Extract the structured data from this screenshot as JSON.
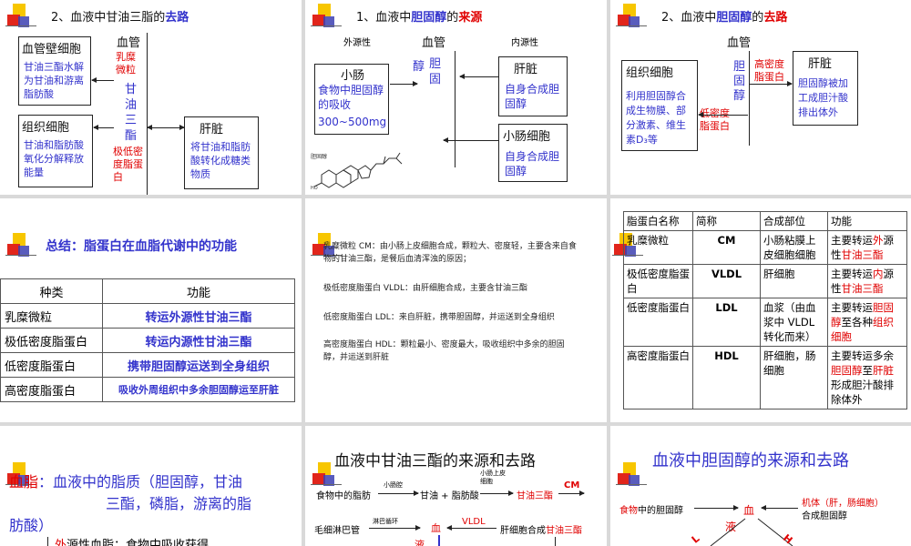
{
  "s1": {
    "title_prefix": "2、血液中甘油三脂的",
    "title_hl": "去路",
    "vessel": "血管",
    "cm": "乳糜微粒",
    "glycerol": "甘油三酯",
    "vldl": "极低密度脂蛋白",
    "wall_hd": "血管壁细胞",
    "wall_txt": "甘油三酯水解为甘油和游离脂肪酸",
    "tissue_hd": "组织细胞",
    "tissue_txt": "甘油和脂肪酸氧化分解释放能量",
    "liver_hd": "肝脏",
    "liver_txt": "将甘油和脂肪酸转化成糖类物质"
  },
  "s2": {
    "title_prefix": "1、血液中",
    "title_blue": "胆固醇",
    "title_mid": "的",
    "title_red": "来源",
    "exo": "外源性",
    "vessel": "血管",
    "endo": "内源性",
    "col_a": "醇",
    "col_b": "胆固",
    "sm_hd": "小肠",
    "sm_txt": "食物中胆固醇的吸收",
    "sm_amt": "300~500mg",
    "mol": "胆固醇",
    "liver_hd": "肝脏",
    "liver_txt": "自身合成胆固醇",
    "cell_hd": "小肠细胞",
    "cell_txt": "自身合成胆固醇"
  },
  "s3": {
    "title_prefix": "2、血液中",
    "title_blue": "胆固醇",
    "title_mid": "的",
    "title_red": "去路",
    "vessel": "血管",
    "chol": "胆固醇",
    "hdl": "高密度脂蛋白",
    "ldl": "低密度脂蛋白",
    "tissue_hd": "组织细胞",
    "tissue_txt": "利用胆固醇合成生物膜、部分激素、维生素D₃等",
    "liver_hd": "肝脏",
    "liver_txt": "胆固醇被加工成胆汁酸排出体外"
  },
  "s4": {
    "title": "总结：脂蛋白在血脂代谢中的功能",
    "head": [
      "种类",
      "功能"
    ],
    "rows": [
      [
        "乳糜微粒",
        "转运外源性甘油三酯"
      ],
      [
        "极低密度脂蛋白",
        "转运内源性甘油三酯"
      ],
      [
        "低密度脂蛋白",
        "携带胆固醇运送到全身组织"
      ],
      [
        "高密度脂蛋白",
        "吸收外周组织中多余胆固醇运至肝脏"
      ]
    ]
  },
  "s5": {
    "p1": "乳糜微粒 CM：由小肠上皮细胞合成，颗粒大、密度轻，主要含来自食物的甘油三酯，是餐后血清浑浊的原因；",
    "p2": "极低密度脂蛋白 VLDL：由肝细胞合成，主要含甘油三酯",
    "p3": "低密度脂蛋白 LDL：来自肝脏，携带胆固醇，并运送到全身组织",
    "p4": "高密度脂蛋白 HDL：颗粒最小、密度最大，吸收组织中多余的胆固醇，并运送到肝脏"
  },
  "s6": {
    "head": [
      "脂蛋白名称",
      "简称",
      "合成部位",
      "功能"
    ],
    "r1": [
      "乳糜微粒",
      "CM",
      "小肠粘膜上皮细胞细胞",
      "主要转运",
      "外",
      "源性",
      "甘油三酯"
    ],
    "r2": [
      "极低密度脂蛋白",
      "VLDL",
      "肝细胞",
      "主要转运",
      "内",
      "源性",
      "甘油三酯"
    ],
    "r3": [
      "低密度脂蛋白",
      "LDL",
      "血浆（由血浆中 VLDL 转化而来）",
      "主要转运",
      "胆固醇",
      "至各种",
      "组织细胞"
    ],
    "r4": [
      "高密度脂蛋白",
      "HDL",
      "肝细胞，肠细胞",
      "主要转运多余",
      "胆固醇",
      "至",
      "肝脏",
      "形成胆汁酸排除体外"
    ]
  },
  "s7": {
    "l1_red": "血脂",
    "l1": "：血液中的脂质（胆固醇，甘油",
    "l2": "三酯，磷脂，游离的脂",
    "l3": "肪酸）",
    "l4_red": "外",
    "l4": "源性血脂：食物中吸收获得"
  },
  "s8": {
    "title": "血液中甘油三酯的来源和去路",
    "food": "食物中的脂肪",
    "lipase": "小肠腔",
    "prod": "甘油 + 脂肪酸",
    "cell": "小肠上皮细胞",
    "tg": "甘油三酯",
    "cm": "CM",
    "cap": "毛细淋巴管",
    "lymph": "淋巴循环",
    "blood": "血",
    "liquid": "液",
    "vldl": "VLDL",
    "liver_prefix": "肝细胞合成",
    "liver_tg": "甘油三酯"
  },
  "s9": {
    "title": "血液中胆固醇的来源和去路",
    "food_red": "食物",
    "food": "中的胆固醇",
    "blood": "血",
    "liquid": "液",
    "body": "机体（肝，肠细胞）",
    "synth": "合成胆固醇",
    "ldl_frag": "L",
    "hdl_frag": "H"
  }
}
